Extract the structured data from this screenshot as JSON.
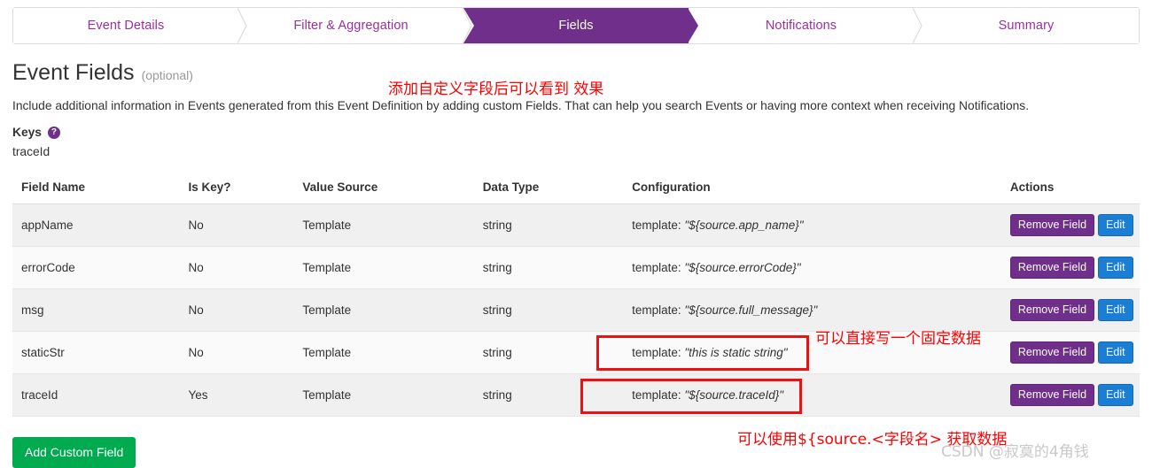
{
  "wizard": {
    "steps": [
      {
        "label": "Event Details",
        "active": false
      },
      {
        "label": "Filter & Aggregation",
        "active": false
      },
      {
        "label": "Fields",
        "active": true
      },
      {
        "label": "Notifications",
        "active": false
      },
      {
        "label": "Summary",
        "active": false
      }
    ]
  },
  "header": {
    "title": "Event Fields",
    "optional": "(optional)",
    "description": "Include additional information in Events generated from this Event Definition by adding custom Fields. That can help you search Events or having more context when receiving Notifications.",
    "keys_label": "Keys",
    "keys_help_icon": "question-mark-icon",
    "keys_value": "traceId"
  },
  "table": {
    "columns": [
      "Field Name",
      "Is Key?",
      "Value Source",
      "Data Type",
      "Configuration",
      "Actions"
    ],
    "rows": [
      {
        "field_name": "appName",
        "is_key": "No",
        "value_source": "Template",
        "data_type": "string",
        "config_prefix": "template: ",
        "config_value": "\"${source.app_name}\"",
        "remove_label": "Remove Field",
        "edit_label": "Edit"
      },
      {
        "field_name": "errorCode",
        "is_key": "No",
        "value_source": "Template",
        "data_type": "string",
        "config_prefix": "template: ",
        "config_value": "\"${source.errorCode}\"",
        "remove_label": "Remove Field",
        "edit_label": "Edit"
      },
      {
        "field_name": "msg",
        "is_key": "No",
        "value_source": "Template",
        "data_type": "string",
        "config_prefix": "template: ",
        "config_value": "\"${source.full_message}\"",
        "remove_label": "Remove Field",
        "edit_label": "Edit"
      },
      {
        "field_name": "staticStr",
        "is_key": "No",
        "value_source": "Template",
        "data_type": "string",
        "config_prefix": "template: ",
        "config_value": "\"this is static string\"",
        "remove_label": "Remove Field",
        "edit_label": "Edit"
      },
      {
        "field_name": "traceId",
        "is_key": "Yes",
        "value_source": "Template",
        "data_type": "string",
        "config_prefix": "template: ",
        "config_value": "\"${source.traceId}\"",
        "remove_label": "Remove Field",
        "edit_label": "Edit"
      }
    ]
  },
  "actions": {
    "add_custom_field": "Add Custom Field"
  },
  "annotations": {
    "top": "添加自定义字段后可以看到 效果",
    "static_row": "可以直接写一个固定数据",
    "bottom": "可以使用${source.<字段名> 获取数据",
    "color": "#ff0000"
  },
  "watermark": "CSDN @寂寞的4角钱",
  "colors": {
    "active_tab": "#702F8A",
    "tab_text": "#9b2fa0",
    "remove_button": "#702F8A",
    "edit_button": "#1a7fd4",
    "add_button": "#00AA4F",
    "annotation_red": "#ee1111"
  }
}
